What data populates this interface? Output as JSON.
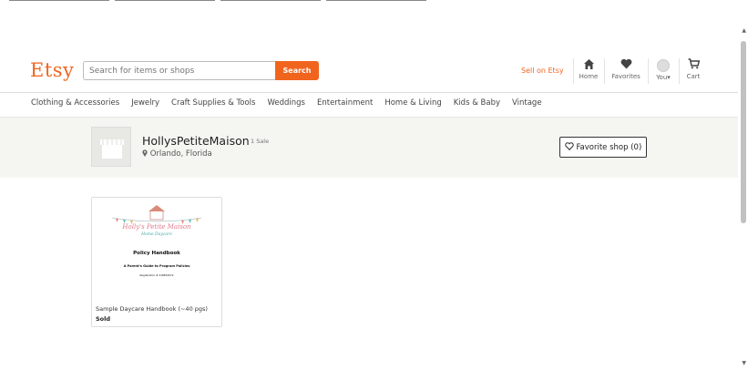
{
  "header": {
    "logo": "Etsy",
    "search_placeholder": "Search for items or shops",
    "search_button": "Search",
    "sell_link": "Sell on Etsy",
    "nav": {
      "home": "Home",
      "favorites": "Favorites",
      "you": "You",
      "cart": "Cart"
    }
  },
  "categories": [
    "Clothing & Accessories",
    "Jewelry",
    "Craft Supplies & Tools",
    "Weddings",
    "Entertainment",
    "Home & Living",
    "Kids & Baby",
    "Vintage"
  ],
  "shop": {
    "name": "HollysPetiteMaison",
    "sales": "1 Sale",
    "location": "Orlando, Florida",
    "favorite_button": "Favorite shop (0)"
  },
  "listing": {
    "title": "Sample Daycare Handbook (~40 pgs)",
    "status": "Sold",
    "image": {
      "brand_line1": "Holly's Petite Maison",
      "brand_line2": "Home Daycare",
      "heading": "Policy Handbook",
      "subheading": "A Parent's Guide to Program Policies",
      "registration": "Registration # 418652072"
    }
  }
}
